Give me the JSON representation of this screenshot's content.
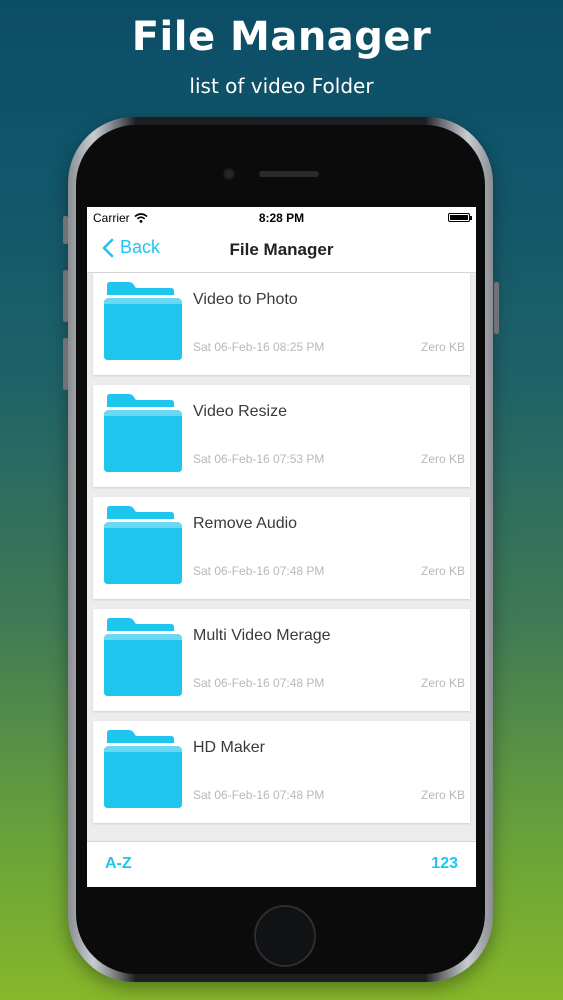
{
  "promo": {
    "title": "File Manager",
    "subtitle": "list of video Folder"
  },
  "status_bar": {
    "carrier": "Carrier",
    "time": "8:28 PM"
  },
  "nav": {
    "back_label": "Back",
    "title": "File Manager"
  },
  "folders": [
    {
      "name": "Video to Photo",
      "date": "Sat 06-Feb-16 08:25 PM",
      "size": "Zero KB"
    },
    {
      "name": "Video Resize",
      "date": "Sat 06-Feb-16 07:53 PM",
      "size": "Zero KB"
    },
    {
      "name": "Remove Audio",
      "date": "Sat 06-Feb-16 07:48 PM",
      "size": "Zero KB"
    },
    {
      "name": "Multi Video Merage",
      "date": "Sat 06-Feb-16 07:48 PM",
      "size": "Zero KB"
    },
    {
      "name": "HD Maker",
      "date": "Sat 06-Feb-16 07:48 PM",
      "size": "Zero KB"
    }
  ],
  "bottom_bar": {
    "sort_alpha_label": "A-Z",
    "sort_numeric_label": "123"
  },
  "colors": {
    "accent": "#1ec5ef",
    "folder": "#1ec5ef"
  },
  "icons": {
    "back": "chevron-left-icon",
    "wifi": "wifi-icon",
    "battery": "battery-icon",
    "folder": "folder-icon"
  }
}
